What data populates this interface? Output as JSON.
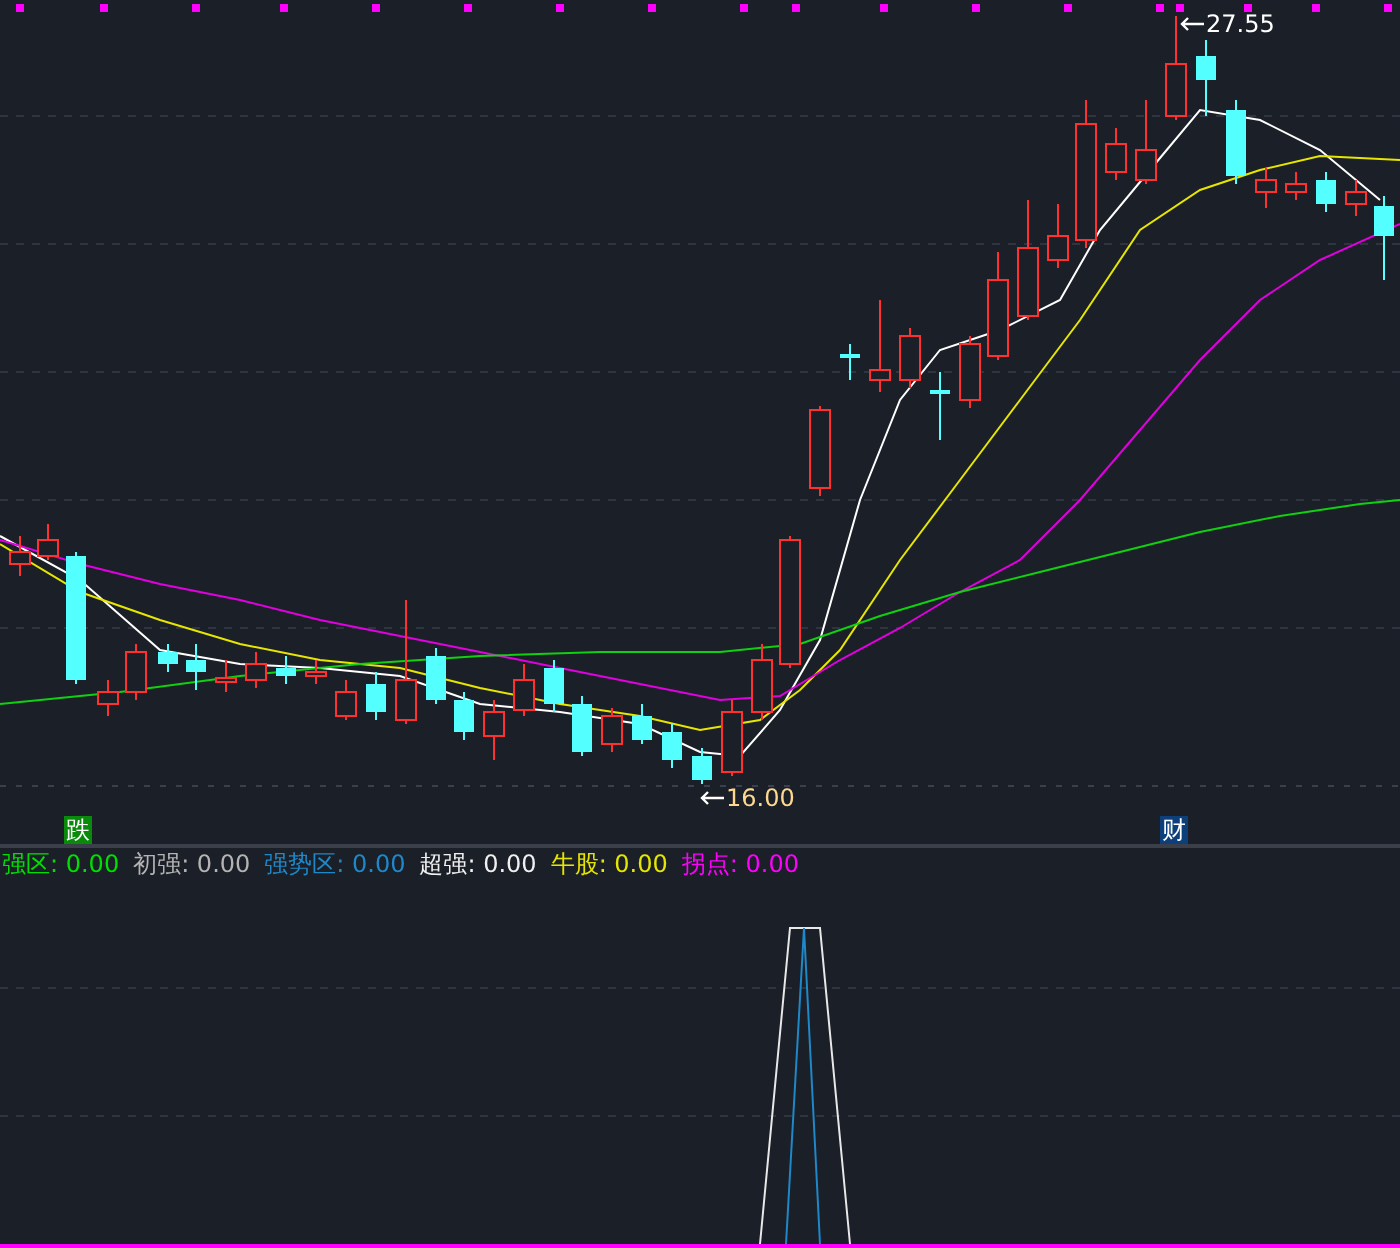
{
  "chart": {
    "high_label": {
      "text": "27.55"
    },
    "low_label": {
      "text": "16.00"
    },
    "signals": [
      {
        "text": "跌",
        "color": "#0a8a0a"
      },
      {
        "text": "财",
        "color": "#0d3f7a"
      }
    ]
  },
  "legend": [
    {
      "text": "强区: 0.00",
      "color": "#00e000"
    },
    {
      "text": "初强: 0.00",
      "color": "#b4b4b4"
    },
    {
      "text": "强势区: 0.00",
      "color": "#1e88c8"
    },
    {
      "text": "超强: 0.00",
      "color": "#f0f0f0"
    },
    {
      "text": "牛股: 0.00",
      "color": "#e6e600"
    },
    {
      "text": "拐点: 0.00",
      "color": "#ff00ff"
    }
  ]
}
